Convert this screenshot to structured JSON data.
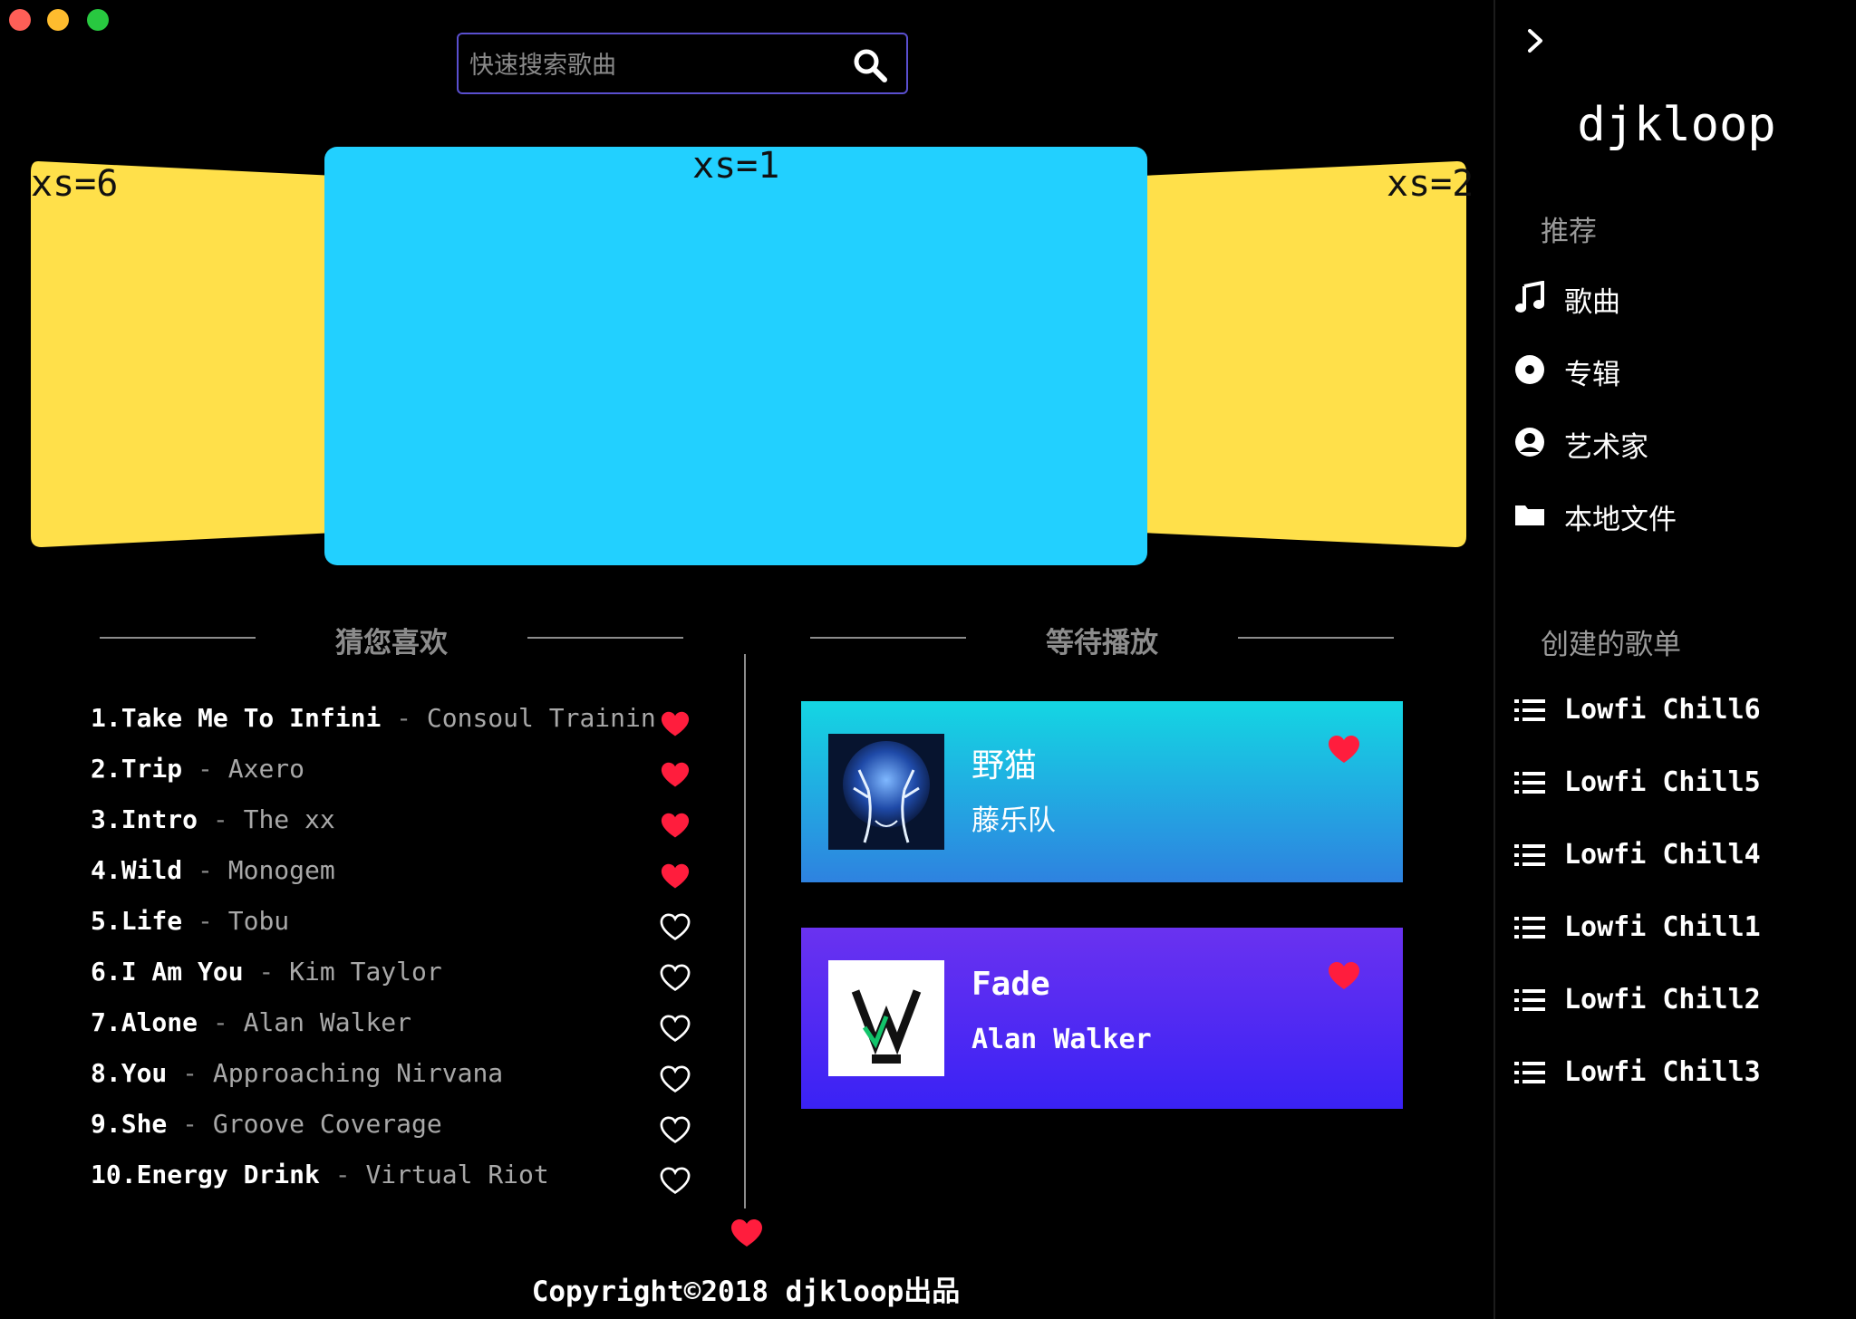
{
  "window": {
    "controls": [
      {
        "name": "close",
        "color": "#fe5f57"
      },
      {
        "name": "minimize",
        "color": "#febc2e"
      },
      {
        "name": "zoom",
        "color": "#28c840"
      }
    ]
  },
  "search": {
    "placeholder": "快速搜索歌曲",
    "icon": "search-icon"
  },
  "carousel": {
    "slides": [
      {
        "label": "xs=6",
        "color": "#ffe04a"
      },
      {
        "label": "xs=1",
        "color": "#22d0ff"
      },
      {
        "label": "xs=2",
        "color": "#ffe04a"
      }
    ]
  },
  "recommend": {
    "title": "猜您喜欢",
    "songs": [
      {
        "num": "1.",
        "title": "Take Me To Infini",
        "artist": "Consoul Trainin",
        "liked": true
      },
      {
        "num": "2.",
        "title": "Trip",
        "artist": "Axero",
        "liked": true
      },
      {
        "num": "3.",
        "title": "Intro",
        "artist": "The xx",
        "liked": true
      },
      {
        "num": "4.",
        "title": "Wild",
        "artist": "Monogem",
        "liked": true
      },
      {
        "num": "5.",
        "title": "Life",
        "artist": "Tobu",
        "liked": false
      },
      {
        "num": "6.",
        "title": "I Am You",
        "artist": "Kim Taylor",
        "liked": false
      },
      {
        "num": "7.",
        "title": "Alone",
        "artist": "Alan Walker",
        "liked": false
      },
      {
        "num": "8.",
        "title": "You",
        "artist": "Approaching Nirvana",
        "liked": false
      },
      {
        "num": "9.",
        "title": "She",
        "artist": "Groove Coverage",
        "liked": false
      },
      {
        "num": "10.",
        "title": "Energy Drink",
        "artist": "Virtual Riot",
        "liked": false
      }
    ],
    "separator": " - "
  },
  "queue": {
    "title": "等待播放",
    "cards": [
      {
        "title": "野猫",
        "artist": "藤乐队",
        "liked": true,
        "gradient": [
          "#14d6e3",
          "#2e82e0"
        ]
      },
      {
        "title": "Fade",
        "artist": "Alan Walker",
        "liked": true,
        "gradient": [
          "#6a32f0",
          "#3a22f5"
        ]
      }
    ]
  },
  "footer": {
    "text": "Copyright©2018 djkloop出品"
  },
  "sidebar": {
    "title": "djkloop",
    "recommend_header": "推荐",
    "nav": [
      {
        "label": "歌曲",
        "icon": "music-note-icon"
      },
      {
        "label": "专辑",
        "icon": "disc-icon"
      },
      {
        "label": "艺术家",
        "icon": "user-circle-icon"
      },
      {
        "label": "本地文件",
        "icon": "folder-icon"
      }
    ],
    "playlists_header": "创建的歌单",
    "playlists": [
      {
        "label": "Lowfi Chill6",
        "icon": "list-icon"
      },
      {
        "label": "Lowfi Chill5",
        "icon": "list-icon"
      },
      {
        "label": "Lowfi Chill4",
        "icon": "list-icon"
      },
      {
        "label": "Lowfi Chill1",
        "icon": "list-icon"
      },
      {
        "label": "Lowfi Chill2",
        "icon": "list-icon"
      },
      {
        "label": "Lowfi Chill3",
        "icon": "list-icon"
      }
    ]
  }
}
